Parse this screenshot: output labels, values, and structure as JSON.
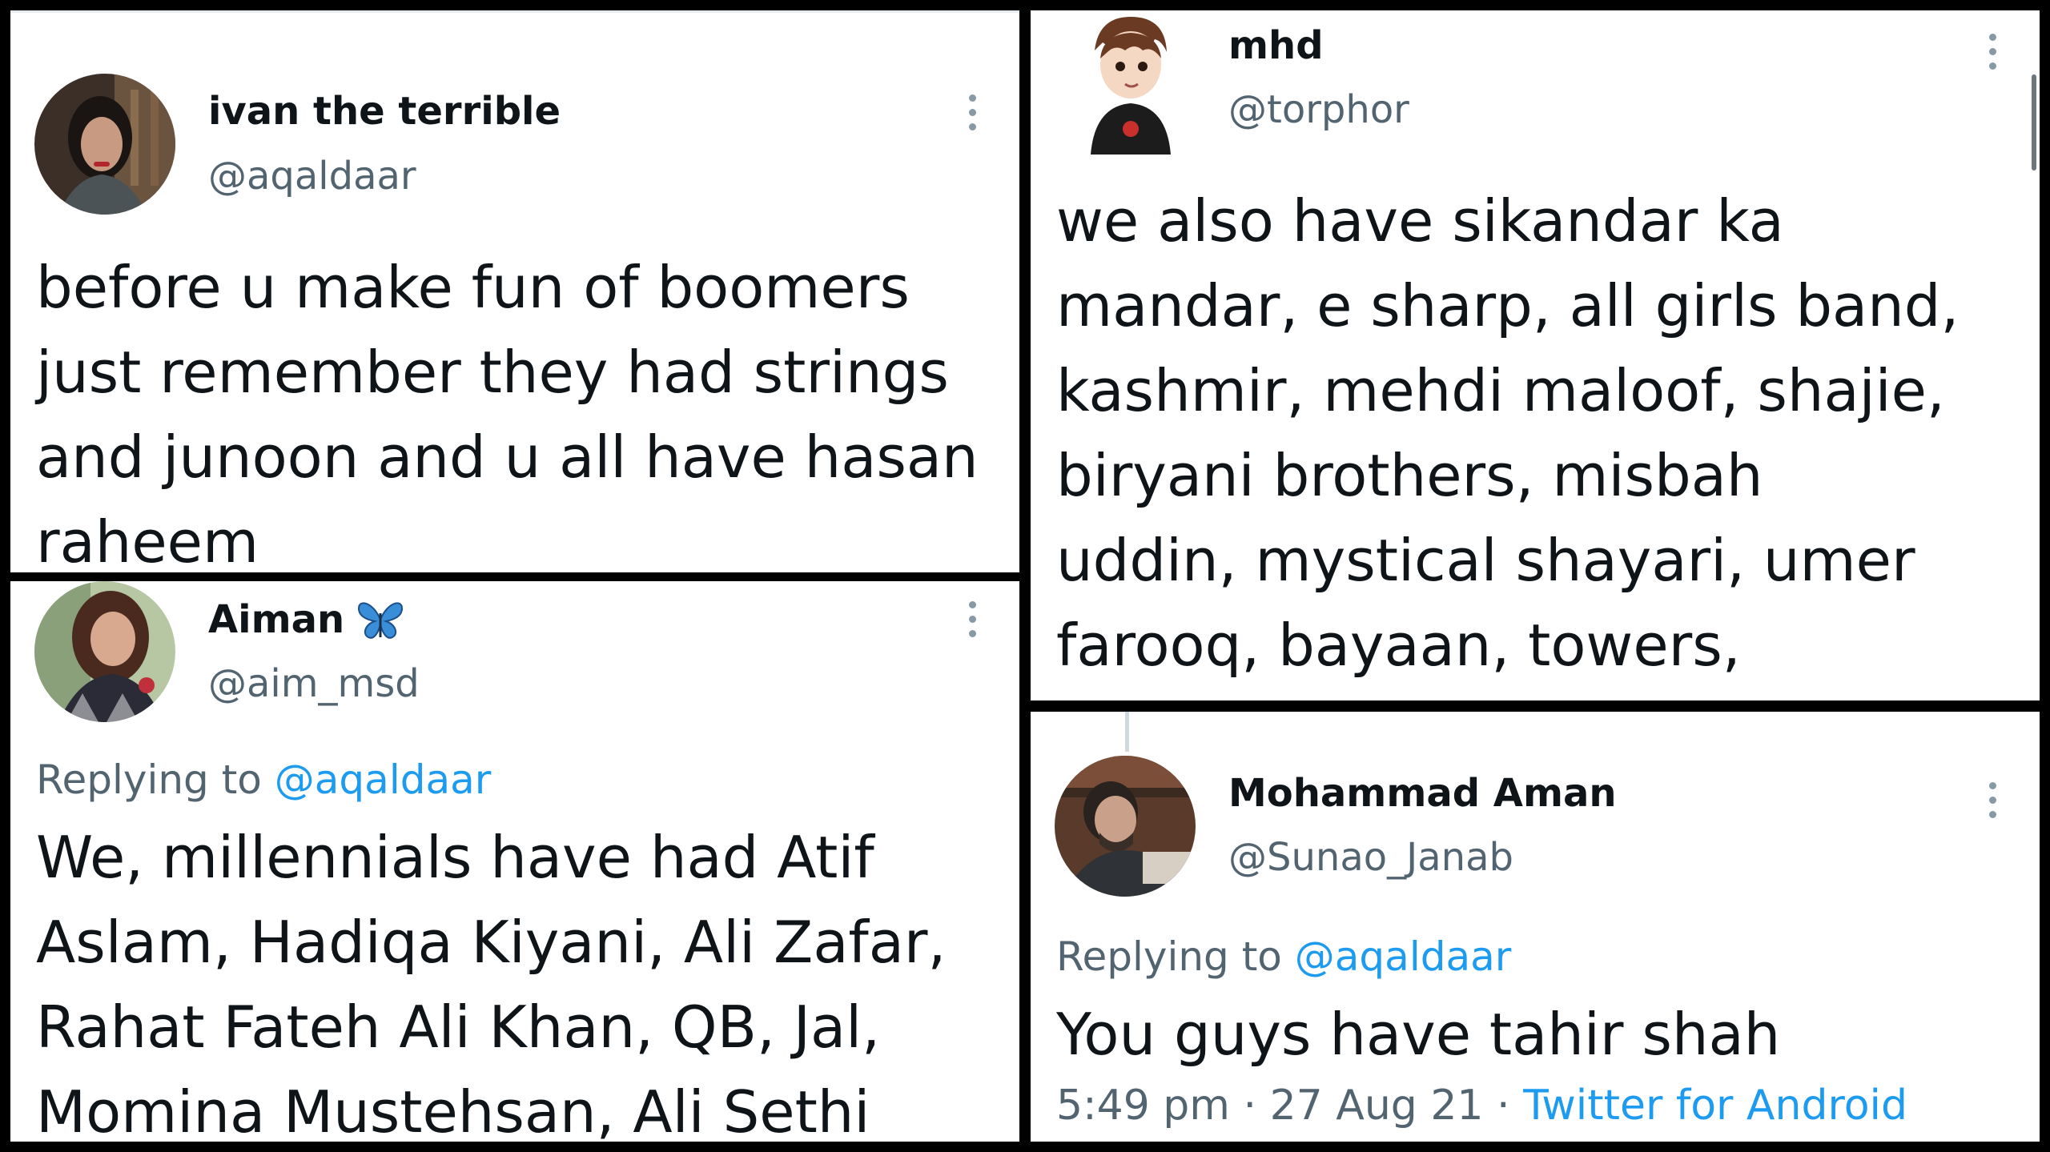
{
  "tweets": {
    "t1": {
      "name": "ivan the terrible",
      "handle": "@aqaldaar",
      "lines": [
        "before u make fun of boomers",
        "just remember they had strings",
        "and junoon and u all have hasan",
        "raheem"
      ]
    },
    "t2": {
      "name": "Aiman",
      "emoji": "🦋",
      "handle": "@aim_msd",
      "replying_prefix": "Replying to",
      "replying_to": "@aqaldaar",
      "lines": [
        "We, millennials have had Atif",
        "Aslam, Hadiqa Kiyani, Ali Zafar,",
        "Rahat Fateh Ali Khan, QB, Jal,",
        "Momina Mustehsan, Ali Sethi"
      ]
    },
    "t3": {
      "name": "mhd",
      "handle": "@torphor",
      "lines": [
        "we also have sikandar ka",
        "mandar, e sharp, all girls band,",
        "kashmir, mehdi maloof, shajie,",
        "biryani brothers, misbah",
        "uddin, mystical shayari, umer",
        "farooq, bayaan, towers,"
      ]
    },
    "t4": {
      "name": "Mohammad Aman",
      "handle": "@Sunao_Janab",
      "replying_prefix": "Replying to",
      "replying_to": "@aqaldaar",
      "lines": [
        "You guys have tahir shah"
      ],
      "time": "5:49 pm",
      "sep": "·",
      "date": "27 Aug 21",
      "source": "Twitter for Android"
    }
  },
  "icons": {
    "more": "more-vertical-icon",
    "verified_emoji": "butterfly-emoji"
  },
  "colors": {
    "link": "#1d9bf0",
    "secondary": "#536471",
    "text": "#0f1419",
    "background": "#000000"
  }
}
